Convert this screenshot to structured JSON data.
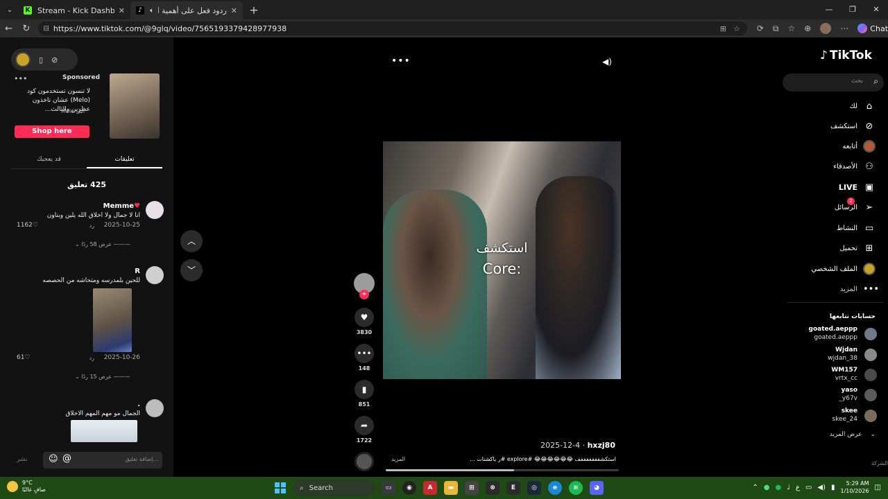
{
  "browser": {
    "tabs": [
      {
        "title": "Stream - Kick Dashboard",
        "active": false
      },
      {
        "title": "ردود فعل على أهمية الأخلاق وا...",
        "active": true
      }
    ],
    "url": "https://www.tiktok.com/@9glq/video/7565193379428977938",
    "chat_label": "Chat"
  },
  "left_panel": {
    "ad": {
      "sponsored_label": "Sponsored",
      "text": "لا تنسون تستخدمون كود (Melo) عشان تاخذون عطرين والثالث...",
      "meta": "أمل Melo",
      "cta": "Shop here"
    },
    "tabs": [
      {
        "label": "تعليقات",
        "active": true
      },
      {
        "label": "قد يعجبك",
        "active": false
      }
    ],
    "comment_count": "425 تعليق",
    "comments": [
      {
        "name": "Memme",
        "text": "انا لا جمال ولا اخلاق الله يلين وبناون",
        "date": "2025-10-25",
        "reply": "رد",
        "likes": "1162",
        "view_replies": "عرض 58 ردًا"
      },
      {
        "name": "R",
        "text": "للحين بلمدرسه ومتحاشه من الحصصه",
        "date": "2025-10-26",
        "reply": "رد",
        "likes": "61",
        "view_replies": "عرض 15 ردًا"
      },
      {
        "name": ".",
        "text": "الجمال مو مهم المهم الاخلاق",
        "date": "",
        "reply": "",
        "likes": "",
        "view_replies": ""
      }
    ],
    "composer": {
      "placeholder": "إضافة تعليق...",
      "post_label": "نشر"
    }
  },
  "video": {
    "caption_line1": "استكشف",
    "caption_line2": "Core:",
    "likes": "3830",
    "comments": "148",
    "saves": "851",
    "shares": "1722",
    "author": "hxzj80",
    "date": "2025-12-4",
    "description": "استكشفففففففف 😂😂😂😂😂😂 #explore #ر ياكشنات ...",
    "more_label": "المزيد",
    "progress": 0.55
  },
  "right_nav": {
    "logo": "TikTok",
    "search_placeholder": "بحث",
    "items": [
      {
        "label": "لك",
        "icon": "home-icon"
      },
      {
        "label": "استكشف",
        "icon": "compass-icon"
      },
      {
        "label": "أتابعه",
        "icon": "following-avatar"
      },
      {
        "label": "الأصدقاء",
        "icon": "friends-icon"
      },
      {
        "label": "LIVE",
        "icon": "live-icon"
      },
      {
        "label": "الرسائل",
        "icon": "messages-icon",
        "badge": "2"
      },
      {
        "label": "النشاط",
        "icon": "activity-icon"
      },
      {
        "label": "تحميل",
        "icon": "upload-icon"
      },
      {
        "label": "الملف الشخصي",
        "icon": "profile-avatar"
      },
      {
        "label": "المزيد",
        "icon": "more-icon"
      }
    ],
    "following_header": "حسابات تتابعها",
    "following": [
      {
        "name": "goated.aeppp",
        "username": "goated.aeppp"
      },
      {
        "name": "Wjdan",
        "username": "wjdan_38"
      },
      {
        "name": "WM157",
        "username": "vrtx_cc"
      },
      {
        "name": "yaso",
        "username": "_y67v"
      },
      {
        "name": "skee",
        "username": "skee_24"
      }
    ],
    "see_more": "عرض المزيد",
    "company": "الشركة"
  },
  "taskbar": {
    "weather_temp": "9°C",
    "weather_desc": "صافٍ غالبًا",
    "search_label": "Search",
    "time": "5:29 AM",
    "date": "1/10/2026",
    "lang": "ع"
  }
}
